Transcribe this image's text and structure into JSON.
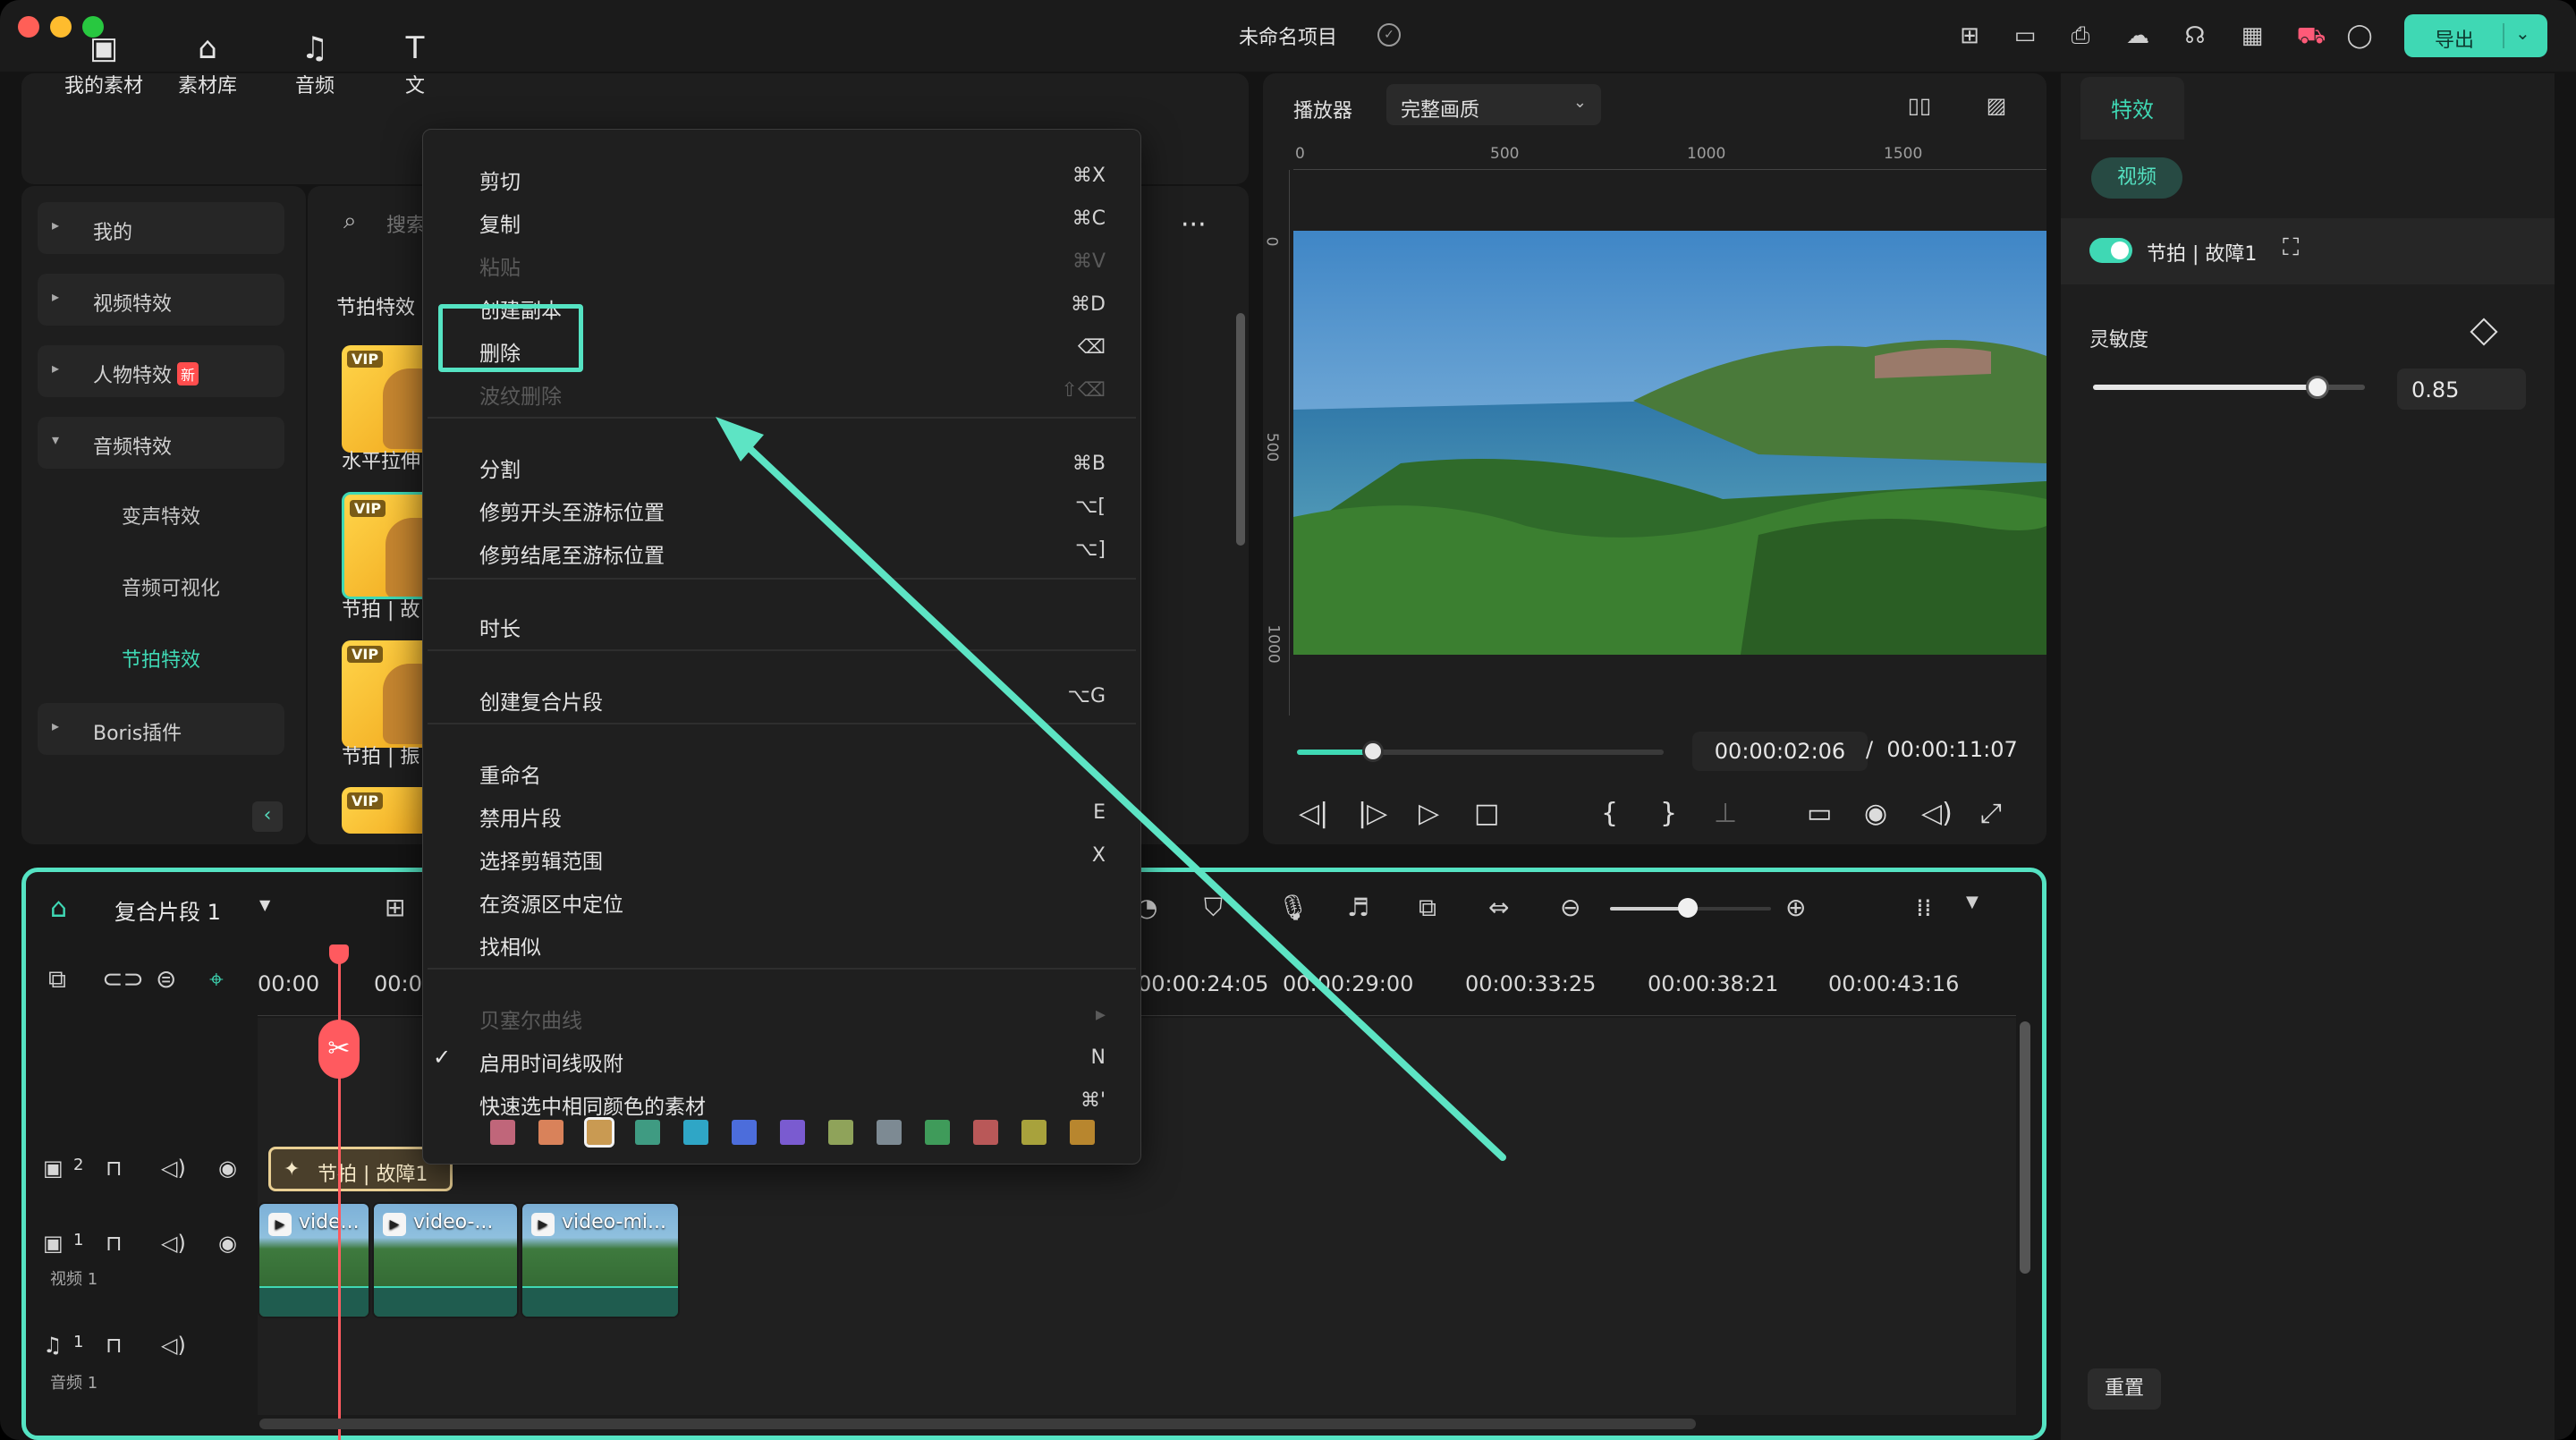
{
  "app": {
    "title": "未命名项目",
    "export_label": "导出"
  },
  "toolbar": {
    "items": [
      {
        "label": "我的素材",
        "icon": "my-media-icon"
      },
      {
        "label": "素材库",
        "icon": "stock-library-icon"
      },
      {
        "label": "音频",
        "icon": "music-note-icon"
      },
      {
        "label": "文",
        "icon": "text-icon"
      }
    ]
  },
  "sidebar": {
    "items": [
      {
        "label": "我的"
      },
      {
        "label": "视频特效"
      },
      {
        "label": "人物特效",
        "badge": "新"
      },
      {
        "label": "音频特效"
      },
      {
        "label": "Boris插件"
      }
    ],
    "subitems": [
      {
        "label": "变声特效"
      },
      {
        "label": "音频可视化"
      },
      {
        "label": "节拍特效"
      }
    ]
  },
  "assets": {
    "search_placeholder": "搜索",
    "section_title": "节拍特效",
    "cards": [
      {
        "badge": "VIP",
        "label": "水平拉伸"
      },
      {
        "badge": "VIP",
        "label": "节拍 | 故"
      },
      {
        "badge": "VIP",
        "label": "节拍 | 振"
      },
      {
        "badge": "VIP",
        "label": ""
      }
    ]
  },
  "player": {
    "label": "播放器",
    "quality": "完整画质",
    "ruler_top": [
      "0",
      "500",
      "1000",
      "1500"
    ],
    "ruler_left": [
      "0",
      "500",
      "1000"
    ],
    "current_time": "00:00:02:06",
    "separator": "/",
    "total_time": "00:00:11:07",
    "progress_fraction": 0.11
  },
  "properties": {
    "tab": "特效",
    "subtab": "视频",
    "effect_name": "节拍 | 故障1",
    "sensitivity_label": "灵敏度",
    "sensitivity_value": "0.85",
    "sensitivity_fraction": 0.85,
    "reset_label": "重置"
  },
  "timeline": {
    "title": "复合片段 1",
    "timecodes": [
      "00:00",
      "00:0",
      "00:00:24:05",
      "00:00:29:00",
      "00:00:33:25",
      "00:00:38:21",
      "00:00:43:16"
    ],
    "tracks": [
      {
        "num": "2",
        "label": ""
      },
      {
        "num": "1",
        "label": "视频 1"
      },
      {
        "num": "1",
        "label": "音频 1"
      }
    ],
    "fx_clip": "节拍 | 故障1",
    "video_clips": [
      "vide...",
      "video-...",
      "video-mi..."
    ]
  },
  "context_menu": {
    "items": [
      {
        "label": "剪切",
        "key": "⌘X",
        "disabled": false
      },
      {
        "label": "复制",
        "key": "⌘C",
        "disabled": false
      },
      {
        "label": "粘贴",
        "key": "⌘V",
        "disabled": true
      },
      {
        "label": "创建副本",
        "key": "⌘D",
        "disabled": false
      },
      {
        "label": "删除",
        "key": "⌫",
        "disabled": false
      },
      {
        "label": "波纹删除",
        "key": "⇧⌫",
        "disabled": true
      },
      {
        "label": "分割",
        "key": "⌘B",
        "disabled": false
      },
      {
        "label": "修剪开头至游标位置",
        "key": "⌥[",
        "disabled": false
      },
      {
        "label": "修剪结尾至游标位置",
        "key": "⌥]",
        "disabled": false
      },
      {
        "label": "时长",
        "key": "",
        "disabled": false
      },
      {
        "label": "创建复合片段",
        "key": "⌥G",
        "disabled": false
      },
      {
        "label": "重命名",
        "key": "",
        "disabled": false
      },
      {
        "label": "禁用片段",
        "key": "E",
        "disabled": false
      },
      {
        "label": "选择剪辑范围",
        "key": "X",
        "disabled": false
      },
      {
        "label": "在资源区中定位",
        "key": "",
        "disabled": false
      },
      {
        "label": "找相似",
        "key": "",
        "disabled": false
      },
      {
        "label": "贝塞尔曲线",
        "key": "▸",
        "disabled": true
      },
      {
        "label": "启用时间线吸附",
        "key": "N",
        "disabled": false,
        "checked": true
      },
      {
        "label": "快速选中相同颜色的素材",
        "key": "⌘'",
        "disabled": false
      }
    ],
    "swatches": [
      "#c0667a",
      "#d9825a",
      "#c99a52",
      "#3f9b82",
      "#2fa6c6",
      "#4c6ddb",
      "#7a5bd0",
      "#8fa35a",
      "#7d8a93",
      "#3f9b5a",
      "#b95858",
      "#a8a23c",
      "#b8862e"
    ]
  }
}
